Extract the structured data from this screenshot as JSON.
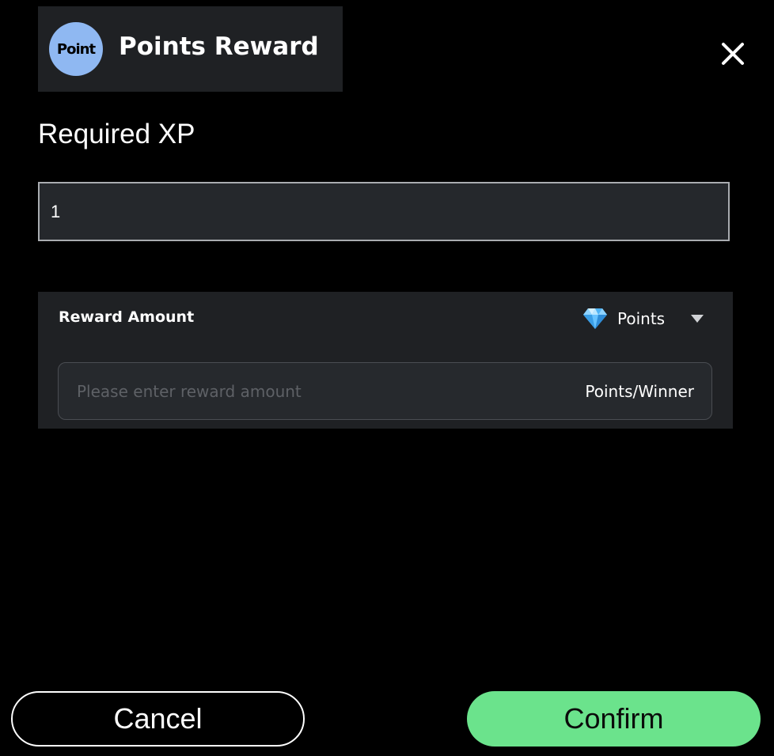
{
  "header": {
    "logo_text": "Point",
    "title": "Points Reward"
  },
  "icons": {
    "close": "close-icon",
    "gem": "diamond-icon",
    "caret": "caret-down-icon"
  },
  "required_xp": {
    "label": "Required XP",
    "value": "1"
  },
  "reward": {
    "label": "Reward Amount",
    "currency": "Points",
    "amount_placeholder": "Please enter reward amount",
    "amount_value": "",
    "suffix": "Points/Winner"
  },
  "actions": {
    "cancel_label": "Cancel",
    "confirm_label": "Confirm"
  },
  "colors": {
    "background": "#000000",
    "panel": "#1f2124",
    "logo_badge": "#8fb8f2",
    "confirm": "#6be38c"
  }
}
